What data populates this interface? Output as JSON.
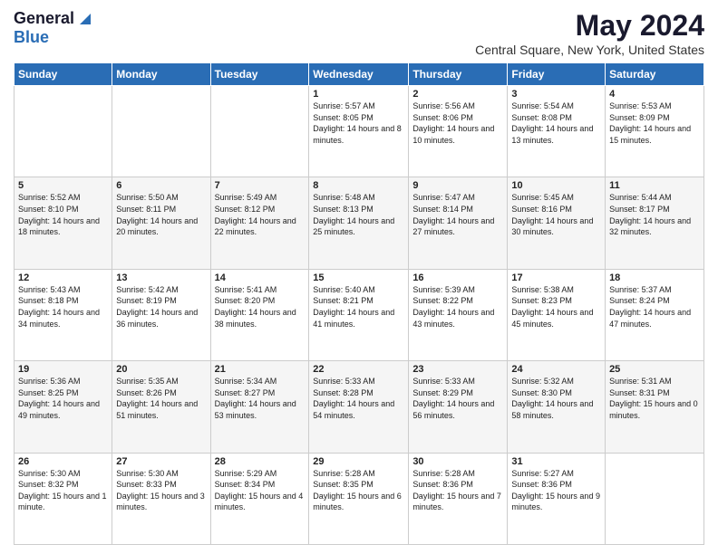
{
  "logo": {
    "general": "General",
    "blue": "Blue"
  },
  "header": {
    "month_year": "May 2024",
    "location": "Central Square, New York, United States"
  },
  "days_of_week": [
    "Sunday",
    "Monday",
    "Tuesday",
    "Wednesday",
    "Thursday",
    "Friday",
    "Saturday"
  ],
  "weeks": [
    [
      {
        "day": "",
        "info": ""
      },
      {
        "day": "",
        "info": ""
      },
      {
        "day": "",
        "info": ""
      },
      {
        "day": "1",
        "info": "Sunrise: 5:57 AM\nSunset: 8:05 PM\nDaylight: 14 hours and 8 minutes."
      },
      {
        "day": "2",
        "info": "Sunrise: 5:56 AM\nSunset: 8:06 PM\nDaylight: 14 hours and 10 minutes."
      },
      {
        "day": "3",
        "info": "Sunrise: 5:54 AM\nSunset: 8:08 PM\nDaylight: 14 hours and 13 minutes."
      },
      {
        "day": "4",
        "info": "Sunrise: 5:53 AM\nSunset: 8:09 PM\nDaylight: 14 hours and 15 minutes."
      }
    ],
    [
      {
        "day": "5",
        "info": "Sunrise: 5:52 AM\nSunset: 8:10 PM\nDaylight: 14 hours and 18 minutes."
      },
      {
        "day": "6",
        "info": "Sunrise: 5:50 AM\nSunset: 8:11 PM\nDaylight: 14 hours and 20 minutes."
      },
      {
        "day": "7",
        "info": "Sunrise: 5:49 AM\nSunset: 8:12 PM\nDaylight: 14 hours and 22 minutes."
      },
      {
        "day": "8",
        "info": "Sunrise: 5:48 AM\nSunset: 8:13 PM\nDaylight: 14 hours and 25 minutes."
      },
      {
        "day": "9",
        "info": "Sunrise: 5:47 AM\nSunset: 8:14 PM\nDaylight: 14 hours and 27 minutes."
      },
      {
        "day": "10",
        "info": "Sunrise: 5:45 AM\nSunset: 8:16 PM\nDaylight: 14 hours and 30 minutes."
      },
      {
        "day": "11",
        "info": "Sunrise: 5:44 AM\nSunset: 8:17 PM\nDaylight: 14 hours and 32 minutes."
      }
    ],
    [
      {
        "day": "12",
        "info": "Sunrise: 5:43 AM\nSunset: 8:18 PM\nDaylight: 14 hours and 34 minutes."
      },
      {
        "day": "13",
        "info": "Sunrise: 5:42 AM\nSunset: 8:19 PM\nDaylight: 14 hours and 36 minutes."
      },
      {
        "day": "14",
        "info": "Sunrise: 5:41 AM\nSunset: 8:20 PM\nDaylight: 14 hours and 38 minutes."
      },
      {
        "day": "15",
        "info": "Sunrise: 5:40 AM\nSunset: 8:21 PM\nDaylight: 14 hours and 41 minutes."
      },
      {
        "day": "16",
        "info": "Sunrise: 5:39 AM\nSunset: 8:22 PM\nDaylight: 14 hours and 43 minutes."
      },
      {
        "day": "17",
        "info": "Sunrise: 5:38 AM\nSunset: 8:23 PM\nDaylight: 14 hours and 45 minutes."
      },
      {
        "day": "18",
        "info": "Sunrise: 5:37 AM\nSunset: 8:24 PM\nDaylight: 14 hours and 47 minutes."
      }
    ],
    [
      {
        "day": "19",
        "info": "Sunrise: 5:36 AM\nSunset: 8:25 PM\nDaylight: 14 hours and 49 minutes."
      },
      {
        "day": "20",
        "info": "Sunrise: 5:35 AM\nSunset: 8:26 PM\nDaylight: 14 hours and 51 minutes."
      },
      {
        "day": "21",
        "info": "Sunrise: 5:34 AM\nSunset: 8:27 PM\nDaylight: 14 hours and 53 minutes."
      },
      {
        "day": "22",
        "info": "Sunrise: 5:33 AM\nSunset: 8:28 PM\nDaylight: 14 hours and 54 minutes."
      },
      {
        "day": "23",
        "info": "Sunrise: 5:33 AM\nSunset: 8:29 PM\nDaylight: 14 hours and 56 minutes."
      },
      {
        "day": "24",
        "info": "Sunrise: 5:32 AM\nSunset: 8:30 PM\nDaylight: 14 hours and 58 minutes."
      },
      {
        "day": "25",
        "info": "Sunrise: 5:31 AM\nSunset: 8:31 PM\nDaylight: 15 hours and 0 minutes."
      }
    ],
    [
      {
        "day": "26",
        "info": "Sunrise: 5:30 AM\nSunset: 8:32 PM\nDaylight: 15 hours and 1 minute."
      },
      {
        "day": "27",
        "info": "Sunrise: 5:30 AM\nSunset: 8:33 PM\nDaylight: 15 hours and 3 minutes."
      },
      {
        "day": "28",
        "info": "Sunrise: 5:29 AM\nSunset: 8:34 PM\nDaylight: 15 hours and 4 minutes."
      },
      {
        "day": "29",
        "info": "Sunrise: 5:28 AM\nSunset: 8:35 PM\nDaylight: 15 hours and 6 minutes."
      },
      {
        "day": "30",
        "info": "Sunrise: 5:28 AM\nSunset: 8:36 PM\nDaylight: 15 hours and 7 minutes."
      },
      {
        "day": "31",
        "info": "Sunrise: 5:27 AM\nSunset: 8:36 PM\nDaylight: 15 hours and 9 minutes."
      },
      {
        "day": "",
        "info": ""
      }
    ]
  ]
}
